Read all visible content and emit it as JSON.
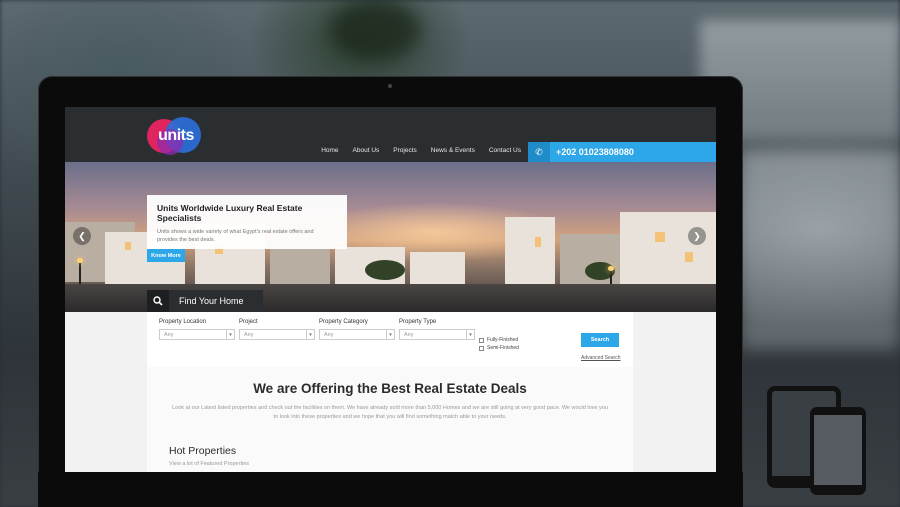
{
  "header": {
    "logo_text": "units",
    "nav": [
      "Home",
      "About Us",
      "Projects",
      "News & Events",
      "Contact Us"
    ],
    "phone": "+202 01023808080"
  },
  "hero": {
    "title": "Units Worldwide Luxury Real Estate Specialists",
    "text": "Units shows a wide variety of what Egypt's real estate offers and provides the best deals.",
    "cta": "Know More",
    "find_label": "Find Your Home"
  },
  "search": {
    "fields": [
      {
        "label": "Property Location",
        "value": "Any"
      },
      {
        "label": "Project",
        "value": "Any"
      },
      {
        "label": "Property Category",
        "value": "Any"
      },
      {
        "label": "Property Type",
        "value": "Any"
      }
    ],
    "checks": [
      "Fully-Finished",
      "Semi-Finished"
    ],
    "button": "Search",
    "advanced": "Advanced Search"
  },
  "offer": {
    "title": "We are Offering the Best Real Estate Deals",
    "text": "Look at our Latest listed properties and check out the facilities on them. We have already sold more than 5,000 Homes and we are still going at very good pace. We would love you to look into these properties and we hope that you will find something match able to your needs.",
    "hot_title": "Hot Properties",
    "hot_sub": "View a lot of Featured Properties"
  },
  "colors": {
    "accent": "#2ea7e8",
    "header_bg": "#2b2e31"
  }
}
